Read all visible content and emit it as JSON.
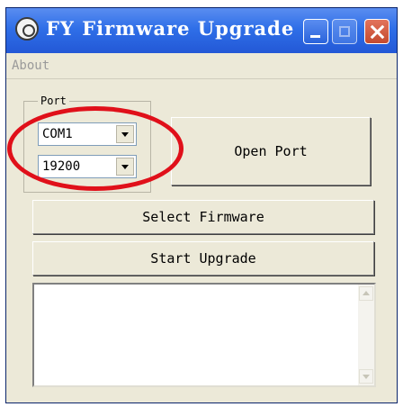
{
  "window": {
    "title": "FY Firmware Upgrade"
  },
  "menu": {
    "about": "About"
  },
  "port_group": {
    "legend": "Port"
  },
  "combos": {
    "port": "COM1",
    "baud": "19200"
  },
  "buttons": {
    "open_port": "Open Port",
    "select_firmware": "Select Firmware",
    "start_upgrade": "Start Upgrade"
  },
  "log": {
    "text": ""
  },
  "annotation": {
    "color": "#e0101a"
  },
  "icons": [
    "app-icon",
    "minimize-icon",
    "maximize-icon",
    "close-icon",
    "chevron-down-icon",
    "scroll-up-icon",
    "scroll-down-icon"
  ]
}
